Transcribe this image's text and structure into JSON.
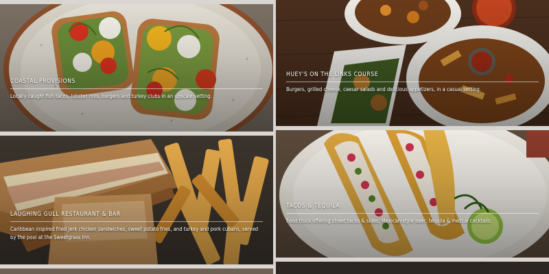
{
  "cards": [
    {
      "title": "COASTAL PROVISIONS",
      "description": "Locally caught fish tacos, lobster rolls, burgers and turkey clubs in an upscale setting.",
      "image": "avocado-toast-plate-photo"
    },
    {
      "title": "HUEY'S ON THE LINKS COURSE",
      "description": "Burgers, grilled cheese, caesar salads and delicious appetizers, in a casual setting.",
      "image": "appetizers-on-wood-table-photo"
    },
    {
      "title": "LAUGHING GULL RESTAURANT & BAR",
      "description": "Caribbean inspired fried jerk chicken sandwiches, sweet potato fries, and turkey and pork cubans, served by the pool at the Sweetgrass Inn.",
      "image": "cuban-sandwich-and-fries-photo"
    },
    {
      "title": "TACOS & TEQUILA",
      "description": "Food truck offering street tacos & sides, Mexican-style beer, tequila & mezcal cocktails.",
      "image": "street-tacos-photo"
    }
  ]
}
